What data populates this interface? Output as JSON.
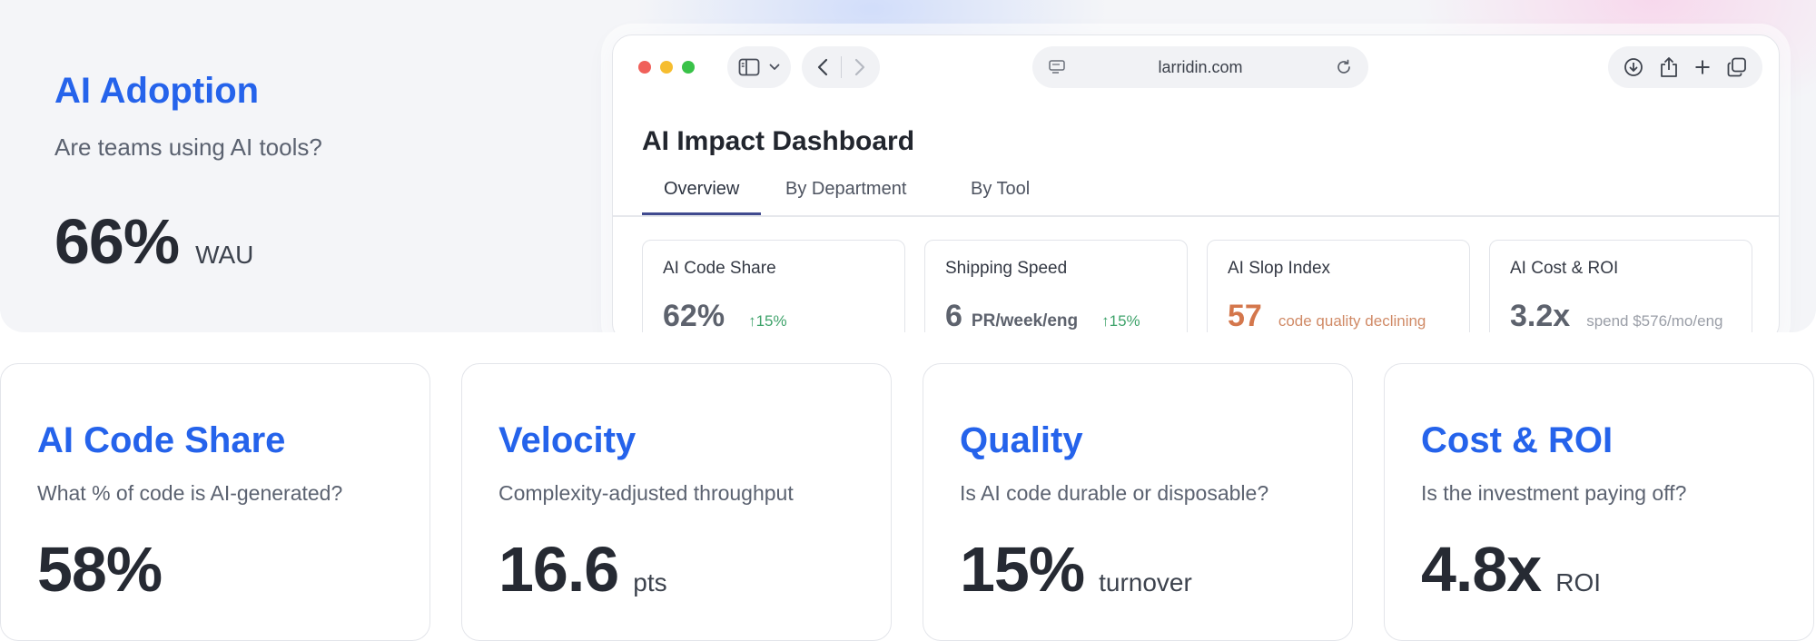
{
  "hero": {
    "title": "AI Adoption",
    "subtitle": "Are teams using AI tools?",
    "value": "66%",
    "unit": "WAU"
  },
  "browser": {
    "url": "larridin.com",
    "icons": [
      "sidebar-icon",
      "chevron-down-icon",
      "back-icon",
      "forward-icon",
      "page-icon",
      "reload-icon",
      "download-icon",
      "share-icon",
      "new-tab-icon",
      "tabs-icon"
    ],
    "dashboard_title": "AI Impact Dashboard",
    "tabs": [
      {
        "label": "Overview",
        "active": true
      },
      {
        "label": "By Department",
        "active": false
      },
      {
        "label": "By Tool",
        "active": false
      }
    ],
    "cards": [
      {
        "label": "AI Code Share",
        "value": "62%",
        "unit": "",
        "delta": "15%",
        "note": ""
      },
      {
        "label": "Shipping Speed",
        "value": "6",
        "unit": "PR/week/eng",
        "delta": "15%",
        "note": ""
      },
      {
        "label": "AI Slop Index",
        "value": "57",
        "unit": "",
        "delta": "",
        "note": "code quality declining"
      },
      {
        "label": "AI Cost & ROI",
        "value": "3.2x",
        "unit": "",
        "delta": "",
        "note": "spend $576/mo/eng"
      }
    ]
  },
  "kpis": [
    {
      "title": "AI Code Share",
      "subtitle": "What % of code is AI-generated?",
      "value": "58%",
      "unit": ""
    },
    {
      "title": "Velocity",
      "subtitle": "Complexity-adjusted throughput",
      "value": "16.6",
      "unit": "pts"
    },
    {
      "title": "Quality",
      "subtitle": "Is AI code durable or disposable?",
      "value": "15%",
      "unit": "turnover"
    },
    {
      "title": "Cost & ROI",
      "subtitle": "Is the investment paying off?",
      "value": "4.8x",
      "unit": "ROI"
    }
  ],
  "colors": {
    "accent": "#2563eb",
    "positive": "#3fa36b",
    "warning": "#d4774c",
    "tab_indicator": "#404a8f"
  }
}
